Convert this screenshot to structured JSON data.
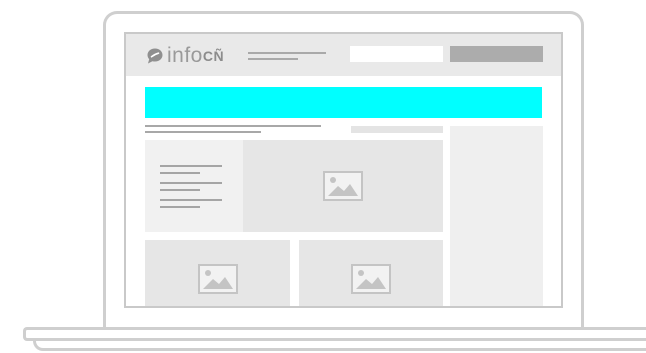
{
  "header": {
    "logo": {
      "text": "info",
      "accent": "CÑ",
      "icon": "speech-bubble-icon"
    },
    "search_button_color": "#acacac"
  },
  "banner": {
    "color": "#00ffff"
  },
  "placeholders": {
    "image_icon": "image-placeholder-icon"
  },
  "colors": {
    "frame": "#cfcfcf",
    "placeholder_gray": "#e6e6e6",
    "text_line_gray": "#a8a8a8"
  }
}
